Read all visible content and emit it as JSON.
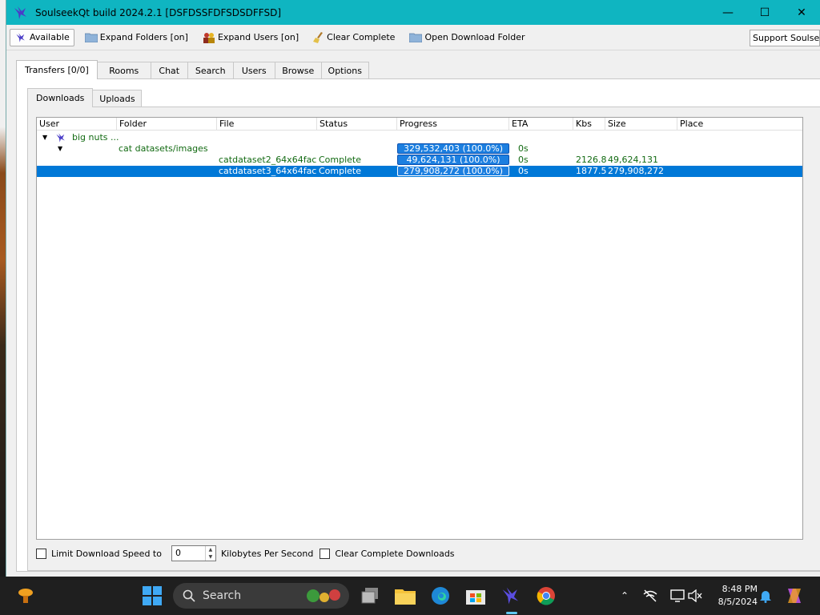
{
  "window": {
    "title": "SoulseekQt build 2024.2.1 [DSFDSSFDFSDSDFFSD]",
    "controls": {
      "minimize": "—",
      "maximize": "☐",
      "close": "✕"
    }
  },
  "toolbar": {
    "available": "Available",
    "expand_folders": "Expand Folders [on]",
    "expand_users": "Expand Users [on]",
    "clear_complete": "Clear Complete",
    "open_download_folder": "Open Download Folder",
    "support": "Support Soulseek"
  },
  "tabs": [
    "Transfers [0/0]",
    "Rooms",
    "Chat",
    "Search",
    "Users",
    "Browse",
    "Options"
  ],
  "subtabs": [
    "Downloads",
    "Uploads"
  ],
  "columns": [
    "User",
    "Folder",
    "File",
    "Status",
    "Progress",
    "ETA",
    "Kbs",
    "Size",
    "Place"
  ],
  "transfers": {
    "user": "big nuts ...",
    "folder": "cat datasets/images",
    "folder_progress": "329,532,403 (100.0%)",
    "folder_eta": "0s",
    "files": [
      {
        "file": "catdataset2_64x64fac...",
        "status": "Complete",
        "progress": "49,624,131 (100.0%)",
        "progress_value": 100,
        "eta": "0s",
        "kbs": "2126.8",
        "size": "49,624,131"
      },
      {
        "file": "catdataset3_64x64fac...",
        "status": "Complete",
        "progress": "279,908,272 (100.0%)",
        "progress_value": 100,
        "eta": "0s",
        "kbs": "1877.5",
        "size": "279,908,272"
      }
    ]
  },
  "footer": {
    "limit_label": "Limit Download Speed to",
    "speed_value": "0",
    "unit_label": "Kilobytes Per Second",
    "clear_label": "Clear Complete Downloads"
  },
  "taskbar": {
    "search_placeholder": "Search",
    "time": "8:48 PM",
    "date": "8/5/2024"
  }
}
